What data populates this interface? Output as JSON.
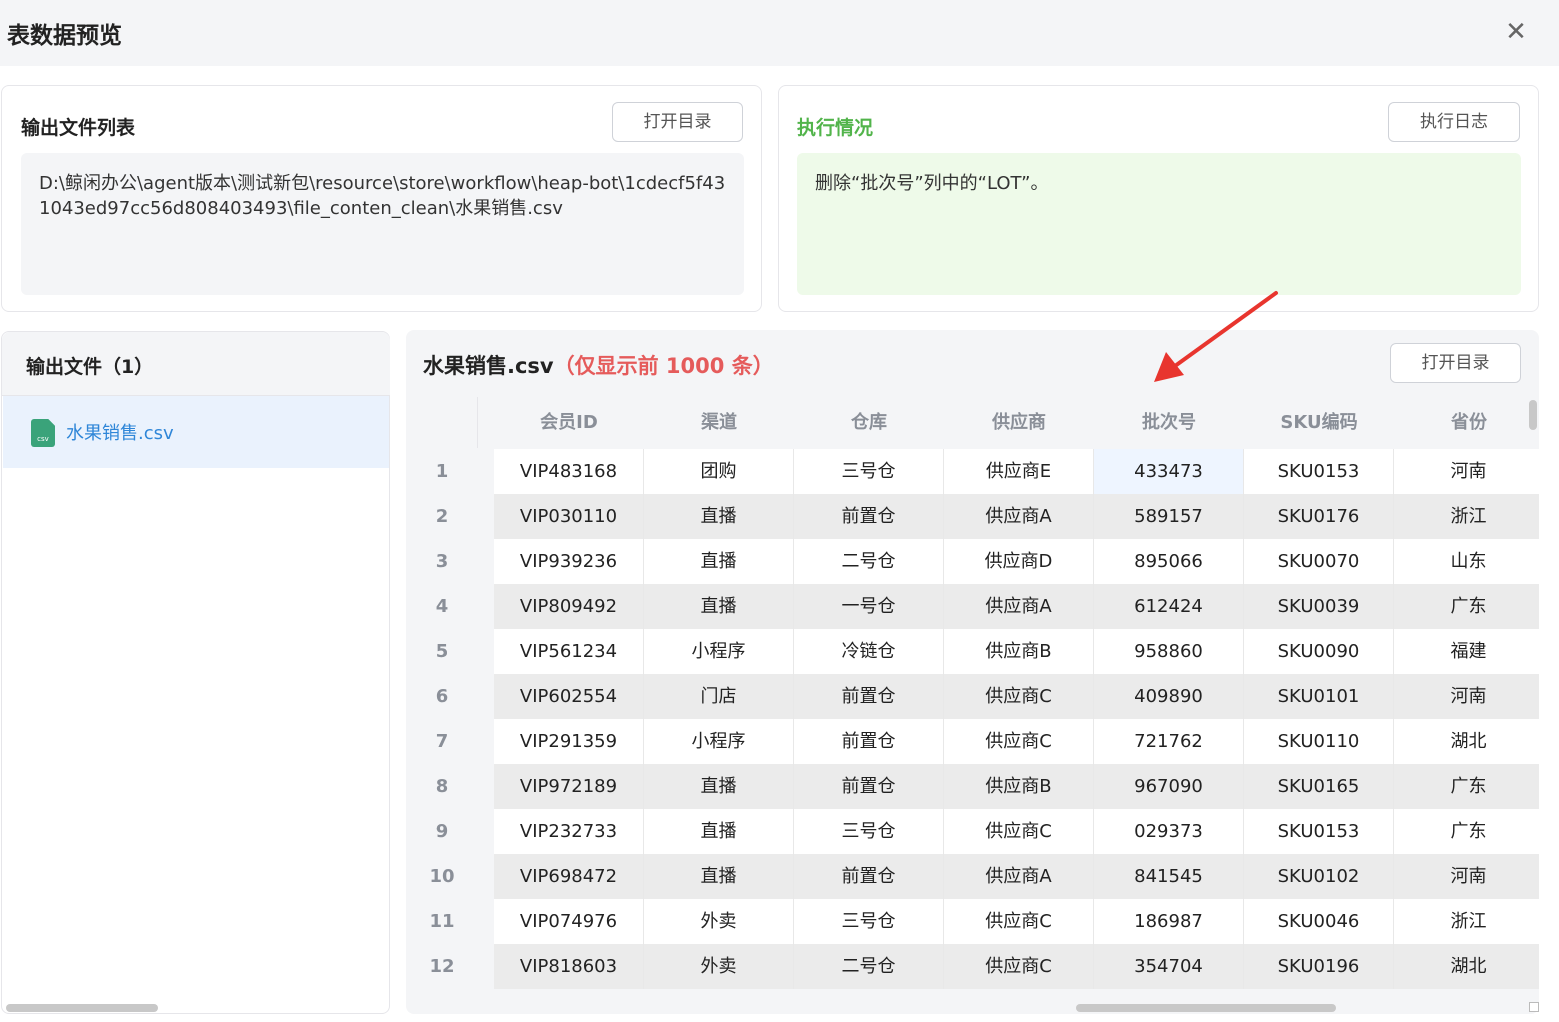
{
  "header": {
    "title": "表数据预览",
    "close_glyph": "✕"
  },
  "output_list": {
    "title": "输出文件列表",
    "open_dir_label": "打开目录",
    "path": "D:\\鲸闲办公\\agent版本\\测试新包\\resource\\store\\workflow\\heap-bot\\1cdecf5f431043ed97cc56d808403493\\file_conten_clean\\水果销售.csv"
  },
  "execution": {
    "title": "执行情况",
    "log_label": "执行日志",
    "message": "删除“批次号”列中的“LOT”。"
  },
  "sidebar": {
    "title": "输出文件（1）",
    "files": [
      {
        "name": "水果销售.csv",
        "icon": "csv-file-icon",
        "icon_text": "csv"
      }
    ]
  },
  "table": {
    "file_name": "水果销售.csv",
    "note": "（仅显示前 1000 条）",
    "open_dir_label": "打开目录",
    "columns": [
      "会员ID",
      "渠道",
      "仓库",
      "供应商",
      "批次号",
      "SKU编码",
      "省份"
    ],
    "rows": [
      {
        "num": "1",
        "cells": [
          "VIP483168",
          "团购",
          "三号仓",
          "供应商E",
          "433473",
          "SKU0153",
          "河南"
        ]
      },
      {
        "num": "2",
        "cells": [
          "VIP030110",
          "直播",
          "前置仓",
          "供应商A",
          "589157",
          "SKU0176",
          "浙江"
        ]
      },
      {
        "num": "3",
        "cells": [
          "VIP939236",
          "直播",
          "二号仓",
          "供应商D",
          "895066",
          "SKU0070",
          "山东"
        ]
      },
      {
        "num": "4",
        "cells": [
          "VIP809492",
          "直播",
          "一号仓",
          "供应商A",
          "612424",
          "SKU0039",
          "广东"
        ]
      },
      {
        "num": "5",
        "cells": [
          "VIP561234",
          "小程序",
          "冷链仓",
          "供应商B",
          "958860",
          "SKU0090",
          "福建"
        ]
      },
      {
        "num": "6",
        "cells": [
          "VIP602554",
          "门店",
          "前置仓",
          "供应商C",
          "409890",
          "SKU0101",
          "河南"
        ]
      },
      {
        "num": "7",
        "cells": [
          "VIP291359",
          "小程序",
          "前置仓",
          "供应商C",
          "721762",
          "SKU0110",
          "湖北"
        ]
      },
      {
        "num": "8",
        "cells": [
          "VIP972189",
          "直播",
          "前置仓",
          "供应商B",
          "967090",
          "SKU0165",
          "广东"
        ]
      },
      {
        "num": "9",
        "cells": [
          "VIP232733",
          "直播",
          "三号仓",
          "供应商C",
          "029373",
          "SKU0153",
          "广东"
        ]
      },
      {
        "num": "10",
        "cells": [
          "VIP698472",
          "直播",
          "前置仓",
          "供应商A",
          "841545",
          "SKU0102",
          "河南"
        ]
      },
      {
        "num": "11",
        "cells": [
          "VIP074976",
          "外卖",
          "三号仓",
          "供应商C",
          "186987",
          "SKU0046",
          "浙江"
        ]
      },
      {
        "num": "12",
        "cells": [
          "VIP818603",
          "外卖",
          "二号仓",
          "供应商C",
          "354704",
          "SKU0196",
          "湖北"
        ]
      }
    ],
    "selected_cell": {
      "row": 0,
      "col": 4
    }
  },
  "colors": {
    "accent_green": "#52b44b",
    "link_blue": "#2f86d8",
    "warning_red": "#e55b5b",
    "annotation_arrow": "#e8352e"
  }
}
